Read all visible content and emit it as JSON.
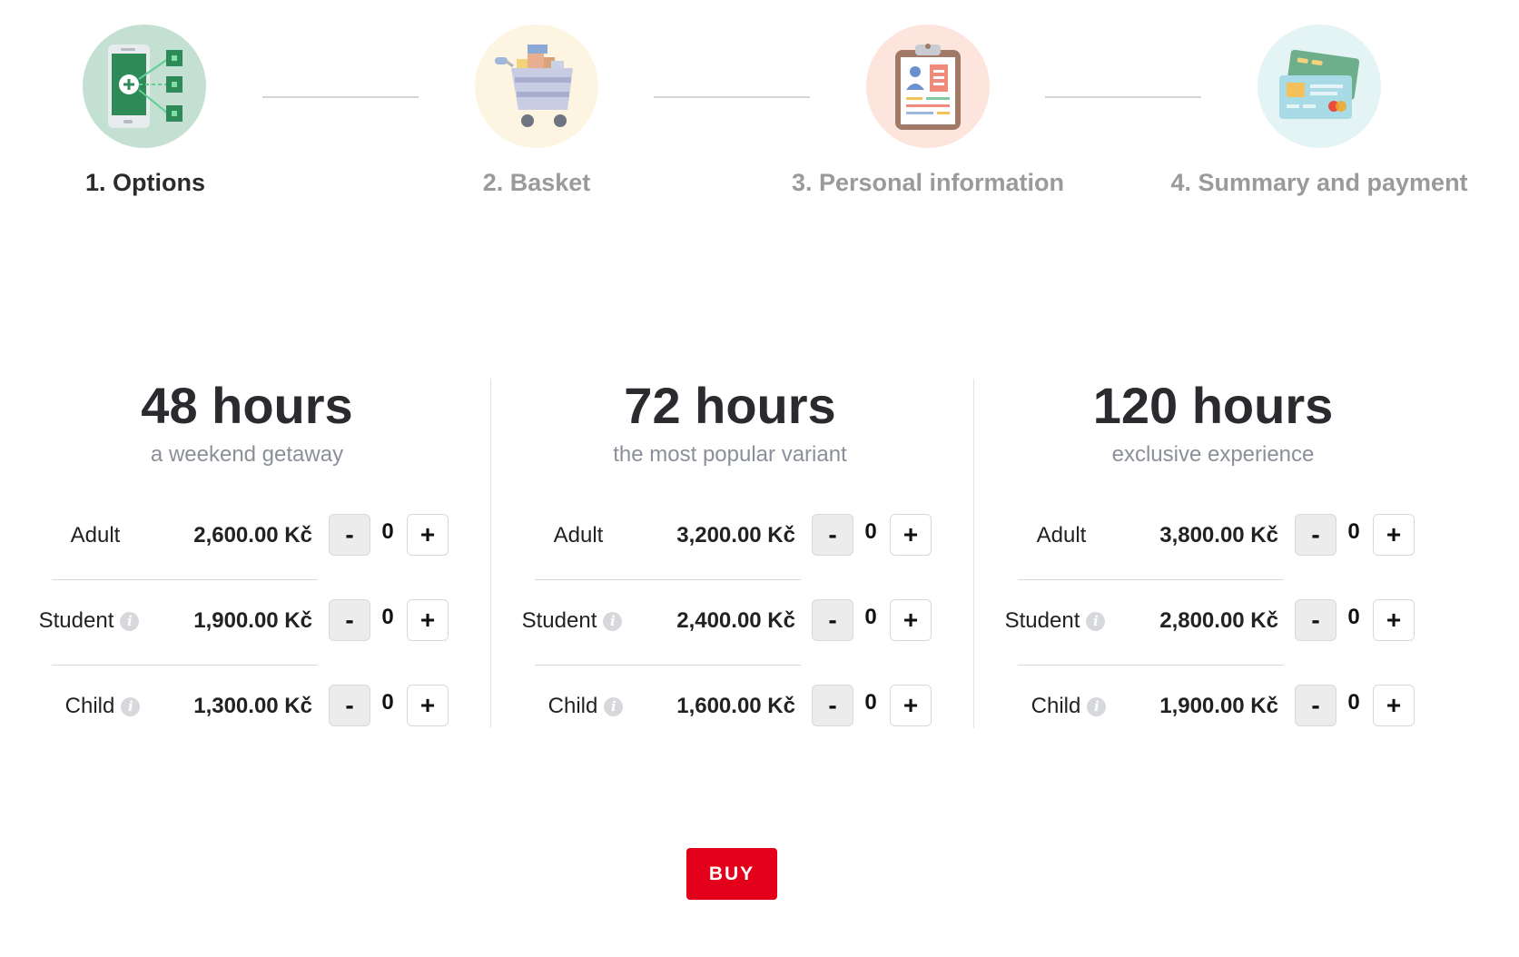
{
  "steps": [
    {
      "label": "1. Options",
      "icon": "phone-options-icon",
      "active": true,
      "bg": "#c4e0d2"
    },
    {
      "label": "2. Basket",
      "icon": "shopping-cart-icon",
      "active": false,
      "bg": "#fdf4e2"
    },
    {
      "label": "3. Personal information",
      "icon": "clipboard-id-icon",
      "active": false,
      "bg": "#fde4dc"
    },
    {
      "label": "4. Summary and payment",
      "icon": "payment-cards-icon",
      "active": false,
      "bg": "#e4f3f3"
    }
  ],
  "plans": [
    {
      "title": "48 hours",
      "subtitle": "a weekend getaway",
      "rows": [
        {
          "label": "Adult",
          "price": "2,600.00 Kč",
          "qty": "0",
          "info": false
        },
        {
          "label": "Student",
          "price": "1,900.00 Kč",
          "qty": "0",
          "info": true
        },
        {
          "label": "Child",
          "price": "1,300.00 Kč",
          "qty": "0",
          "info": true
        }
      ]
    },
    {
      "title": "72 hours",
      "subtitle": "the most popular variant",
      "rows": [
        {
          "label": "Adult",
          "price": "3,200.00 Kč",
          "qty": "0",
          "info": false
        },
        {
          "label": "Student",
          "price": "2,400.00 Kč",
          "qty": "0",
          "info": true
        },
        {
          "label": "Child",
          "price": "1,600.00 Kč",
          "qty": "0",
          "info": true
        }
      ]
    },
    {
      "title": "120 hours",
      "subtitle": "exclusive experience",
      "rows": [
        {
          "label": "Adult",
          "price": "3,800.00 Kč",
          "qty": "0",
          "info": false
        },
        {
          "label": "Student",
          "price": "2,800.00 Kč",
          "qty": "0",
          "info": true
        },
        {
          "label": "Child",
          "price": "1,900.00 Kč",
          "qty": "0",
          "info": true
        }
      ]
    }
  ],
  "controls": {
    "minus": "-",
    "plus": "+",
    "info_glyph": "i"
  },
  "buy_label": "BUY",
  "colors": {
    "accent": "#e2001a",
    "text": "#2b2b2f",
    "muted": "#8a8f98"
  }
}
